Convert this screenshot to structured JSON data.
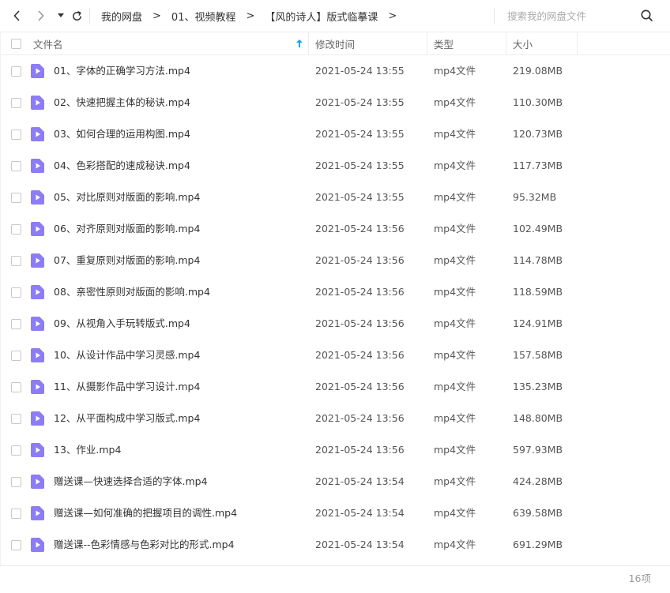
{
  "nav": {
    "back_icon": "chevron-left-icon",
    "forward_icon": "chevron-right-icon",
    "menu_icon": "caret-down-icon",
    "refresh_icon": "refresh-icon"
  },
  "breadcrumb": {
    "items": [
      "我的网盘",
      "01、视频教程",
      "【风的诗人】版式临摹课"
    ],
    "separator": ">"
  },
  "search": {
    "placeholder": "搜索我的网盘文件",
    "icon": "search-icon"
  },
  "table": {
    "headers": {
      "name": "文件名",
      "modified": "修改时间",
      "type": "类型",
      "size": "大小"
    },
    "sort_icon": "sort-up-arrow-icon",
    "accent_color": "#1aa1e8",
    "file_icon_color": "#8c7df5",
    "rows": [
      {
        "name": "01、字体的正确学习方法.mp4",
        "modified": "2021-05-24 13:55",
        "type": "mp4文件",
        "size": "219.08MB"
      },
      {
        "name": "02、快速把握主体的秘诀.mp4",
        "modified": "2021-05-24 13:55",
        "type": "mp4文件",
        "size": "110.30MB"
      },
      {
        "name": "03、如何合理的运用构图.mp4",
        "modified": "2021-05-24 13:55",
        "type": "mp4文件",
        "size": "120.73MB"
      },
      {
        "name": "04、色彩搭配的速成秘诀.mp4",
        "modified": "2021-05-24 13:55",
        "type": "mp4文件",
        "size": "117.73MB"
      },
      {
        "name": "05、对比原则对版面的影响.mp4",
        "modified": "2021-05-24 13:55",
        "type": "mp4文件",
        "size": "95.32MB"
      },
      {
        "name": "06、对齐原则对版面的影响.mp4",
        "modified": "2021-05-24 13:56",
        "type": "mp4文件",
        "size": "102.49MB"
      },
      {
        "name": "07、重复原则对版面的影响.mp4",
        "modified": "2021-05-24 13:56",
        "type": "mp4文件",
        "size": "114.78MB"
      },
      {
        "name": "08、亲密性原则对版面的影响.mp4",
        "modified": "2021-05-24 13:56",
        "type": "mp4文件",
        "size": "118.59MB"
      },
      {
        "name": "09、从视角入手玩转版式.mp4",
        "modified": "2021-05-24 13:56",
        "type": "mp4文件",
        "size": "124.91MB"
      },
      {
        "name": "10、从设计作品中学习灵感.mp4",
        "modified": "2021-05-24 13:56",
        "type": "mp4文件",
        "size": "157.58MB"
      },
      {
        "name": "11、从摄影作品中学习设计.mp4",
        "modified": "2021-05-24 13:56",
        "type": "mp4文件",
        "size": "135.23MB"
      },
      {
        "name": "12、从平面构成中学习版式.mp4",
        "modified": "2021-05-24 13:56",
        "type": "mp4文件",
        "size": "148.80MB"
      },
      {
        "name": "13、作业.mp4",
        "modified": "2021-05-24 13:56",
        "type": "mp4文件",
        "size": "597.93MB"
      },
      {
        "name": "赠送课—快速选择合适的字体.mp4",
        "modified": "2021-05-24 13:54",
        "type": "mp4文件",
        "size": "424.28MB"
      },
      {
        "name": "赠送课—如何准确的把握项目的调性.mp4",
        "modified": "2021-05-24 13:54",
        "type": "mp4文件",
        "size": "639.58MB"
      },
      {
        "name": "赠送课--色彩情感与色彩对比的形式.mp4",
        "modified": "2021-05-24 13:54",
        "type": "mp4文件",
        "size": "691.29MB"
      }
    ]
  },
  "footer": {
    "count": "16项"
  }
}
